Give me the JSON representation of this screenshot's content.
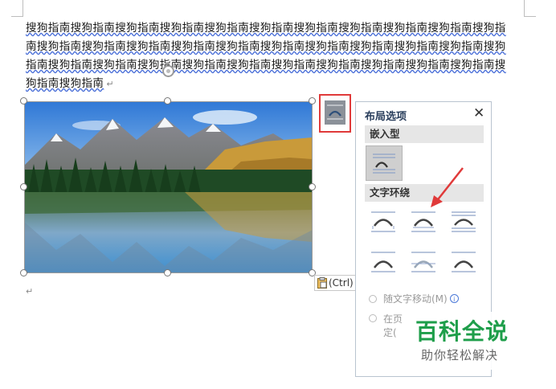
{
  "document": {
    "lines": [
      "搜狗指南搜狗指南搜狗指南搜狗指南搜狗指南搜狗指南搜狗指南搜狗指南搜狗指南搜狗指南搜狗指",
      "南搜狗指南搜狗指南搜狗指南搜狗指南搜狗指南搜狗指南搜狗指南搜狗指南搜狗指南搜狗指南搜狗",
      "指南搜狗指南搜狗指南搜狗指南搜狗指南搜狗指南搜狗指南搜狗指南搜狗指南搜狗指南搜狗指南搜",
      "狗指南搜狗指南"
    ],
    "paragraph_mark": "↵",
    "empty_paragraph_mark": "↵"
  },
  "paste_options": {
    "label": "(Ctrl)",
    "icon": "clipboard-icon"
  },
  "layout_button": {
    "icon": "layout-options-icon"
  },
  "layout_panel": {
    "title": "布局选项",
    "close": "✕",
    "inline_section": "嵌入型",
    "wrap_section": "文字环绕",
    "wrap_options_count": 6,
    "move_with_text": "随文字移动(M)",
    "fix_position_line1": "在页",
    "fix_position_line2": "定("
  },
  "watermark": {
    "title": "百科全说",
    "subtitle": "助你轻松解决"
  },
  "colors": {
    "accent_red": "#e03a3a",
    "watermark_green": "#1e9e4a",
    "panel_heading": "#2a3e5c"
  }
}
